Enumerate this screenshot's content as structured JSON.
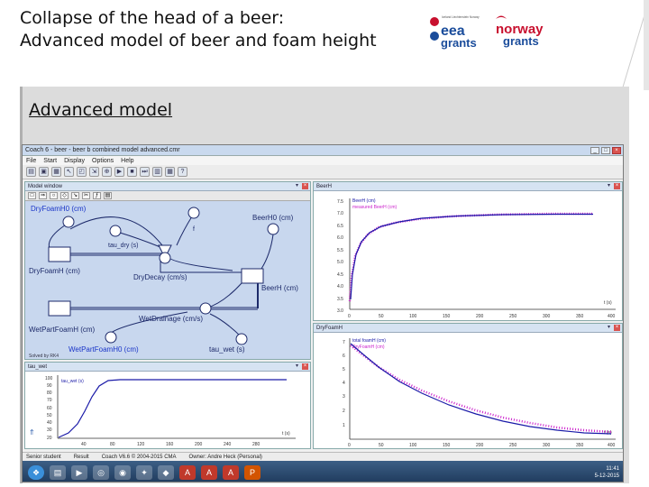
{
  "slide": {
    "title_line1": "Collapse of the head of a beer:",
    "title_line2": "Advanced model of beer and foam height",
    "subtitle": "Advanced model"
  },
  "logos": {
    "eea_small": "Iceland Liechtenstein Norway",
    "eea_main": "eea",
    "eea_sub": "grants",
    "norway_main": "norway",
    "norway_sub": "grants"
  },
  "app": {
    "window_title": "Coach 6 - beer - beer b combined model advanced.cmr",
    "menu": [
      "File",
      "Start",
      "Display",
      "Options",
      "Help"
    ],
    "toolbar_icons": [
      "open-icon",
      "save-icon",
      "print-icon",
      "cursor-icon",
      "select-icon",
      "scale-icon",
      "zoom-icon",
      "run-icon",
      "stop-icon",
      "step-icon",
      "chart-icon",
      "table-icon",
      "help-icon"
    ]
  },
  "model_window": {
    "title": "Model window",
    "footer": "Solved by RK4",
    "nodes": {
      "dry_foam_h0": "DryFoamH0 (cm)",
      "tau_dry": "tau_dry (s)",
      "f": "f",
      "beer_h0": "BeerH0 (cm)",
      "dry_foam_h": "DryFoamH (cm)",
      "dry_decay": "DryDecay (cm/s)",
      "beer_h": "BeerH (cm)",
      "wet_drainage": "WetDrainage (cm/s)",
      "wet_part_foam_h": "WetPartFoamH (cm)",
      "wet_part_foam_h0": "WetPartFoamH0 (cm)",
      "tau_wet": "tau_wet (s)"
    }
  },
  "beer_panel": {
    "title": "BeerH",
    "legend": [
      "BeerH (cm)",
      "measured BeerH (cm)"
    ],
    "x_unit": "t (s)",
    "y_ticks": [
      "7.5",
      "7.0",
      "6.5",
      "6.0",
      "5.5",
      "5.0",
      "4.5",
      "4.0",
      "3.5",
      "3.0"
    ],
    "x_ticks": [
      "0",
      "50",
      "100",
      "150",
      "200",
      "250",
      "300",
      "350",
      "400"
    ]
  },
  "foam_panel": {
    "title": "DryFoamH",
    "legend": [
      "total foamH (cm)",
      "DryFoamH (cm)"
    ],
    "x_unit": "t (s)",
    "y_ticks": [
      "7",
      "6",
      "5",
      "4",
      "3",
      "2",
      "1"
    ],
    "x_ticks": [
      "0",
      "50",
      "100",
      "150",
      "200",
      "250",
      "300",
      "350",
      "400"
    ]
  },
  "tau_panel": {
    "title": "tau_wet",
    "legend": [
      "tau_wet (s)"
    ],
    "x_unit": "t (s)",
    "y_ticks": [
      "100",
      "90",
      "80",
      "70",
      "60",
      "50",
      "40",
      "30",
      "20"
    ],
    "x_ticks": [
      "40",
      "80",
      "120",
      "160",
      "200",
      "240",
      "280"
    ]
  },
  "status": {
    "user": "Senior student",
    "action": "Result",
    "version": "Coach V6.6 © 2004-2015 CMA",
    "owner": "Owner: Andre Heck (Personal)"
  },
  "tray": {
    "time": "11:41",
    "date": "5-12-2015"
  },
  "colors": {
    "model_curve": "#1a1aa8",
    "measured": "#cc22cc",
    "model_bg": "#c8d7ee",
    "diagram_stroke": "#1d2a6a"
  }
}
